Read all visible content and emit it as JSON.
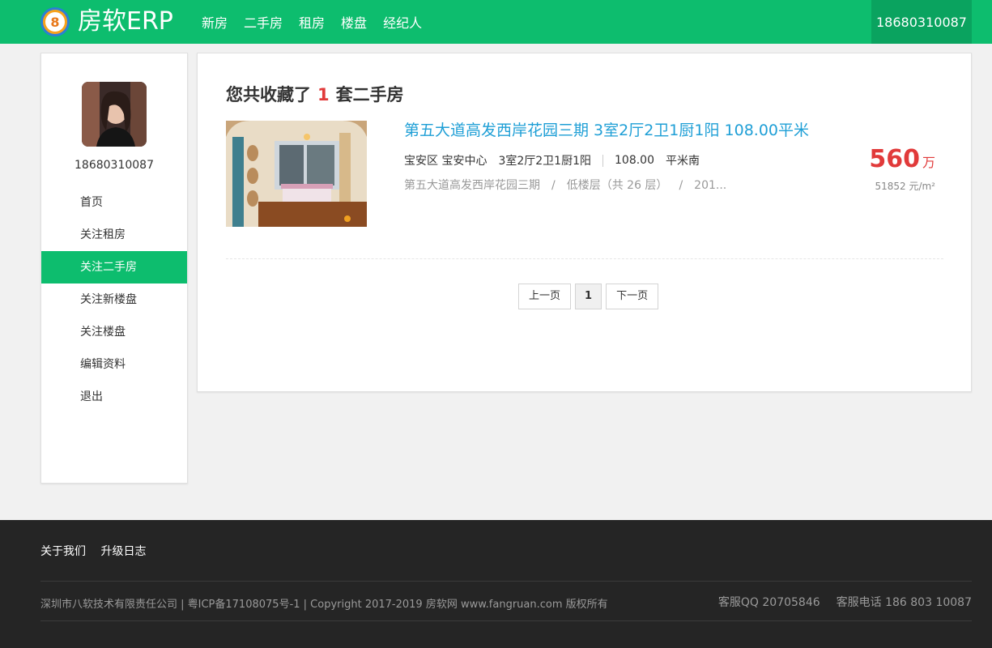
{
  "header": {
    "logo_badge": "8",
    "logo_text": "房软ERP",
    "nav": [
      {
        "label": "新房"
      },
      {
        "label": "二手房"
      },
      {
        "label": "租房"
      },
      {
        "label": "楼盘"
      },
      {
        "label": "经纪人"
      }
    ],
    "user_phone": "18680310087"
  },
  "sidebar": {
    "user_phone": "18680310087",
    "menu": [
      {
        "label": "首页",
        "active": false
      },
      {
        "label": "关注租房",
        "active": false
      },
      {
        "label": "关注二手房",
        "active": true
      },
      {
        "label": "关注新楼盘",
        "active": false
      },
      {
        "label": "关注楼盘",
        "active": false
      },
      {
        "label": "编辑资料",
        "active": false
      },
      {
        "label": "退出",
        "active": false
      }
    ]
  },
  "main": {
    "title_prefix": "您共收藏了",
    "title_count": "1",
    "title_suffix": "套二手房",
    "listing": {
      "title": "第五大道高发西岸花园三期 3室2厅2卫1厨1阳 108.00平米",
      "district": "宝安区 宝安中心",
      "layout": "3室2厅2卫1厨1阳",
      "area": "108.00",
      "orientation": "平米南",
      "community": "第五大道高发西岸花园三期",
      "floor": "低楼层（共 26 层）",
      "year": "201...",
      "price": "560",
      "price_unit": "万",
      "unit_price": "51852 元/m²"
    },
    "pager": {
      "prev": "上一页",
      "current": "1",
      "next": "下一页"
    }
  },
  "footer": {
    "links": [
      "关于我们",
      "升级日志"
    ],
    "copyright": "深圳市八软技术有限责任公司 | 粤ICP备17108075号-1 | Copyright 2017-2019 房软网 www.fangruan.com 版权所有",
    "qq": "客服QQ 20705846",
    "phone": "客服电话 186 803 10087"
  },
  "colors": {
    "brand_green": "#0dbd6e",
    "price_red": "#e13a3a",
    "link_blue": "#1f9fd6"
  }
}
